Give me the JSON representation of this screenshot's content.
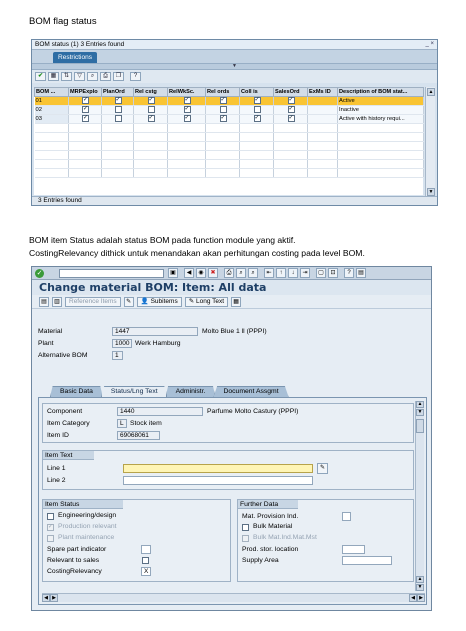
{
  "doc": {
    "heading": "BOM flag status",
    "paragraph_line1": "BOM item Status adalah status BOM pada function module yang aktif.",
    "paragraph_line2": "CostingRelevancy dithick untuk menandakan akan perhitungan costing pada level BOM."
  },
  "popup": {
    "title": "BOM status (1)   3 Entries found",
    "title_buttons": "_ ×",
    "tab_label": "Restrictions",
    "toolbar_icons": [
      "check-icon",
      "table-icon",
      "sort-icon",
      "filter-icon",
      "find-icon",
      "print-icon",
      "copy-icon",
      "help-icon"
    ],
    "columns": [
      "BOM ...",
      "MRPExplo",
      "PlanOrd",
      "Rel cstg",
      "RelWkSc.",
      "Rel ords",
      "Coll is",
      "SalesOrd",
      "ExMs ID",
      "Description of BOM stat..."
    ],
    "rows": [
      {
        "key": "01",
        "flags": [
          true,
          true,
          true,
          true,
          true,
          true,
          true
        ],
        "ext": "",
        "desc": "Active",
        "selected": true
      },
      {
        "key": "02",
        "flags": [
          true,
          false,
          false,
          true,
          false,
          false,
          true
        ],
        "ext": "",
        "desc": "Inactive",
        "selected": false
      },
      {
        "key": "03",
        "flags": [
          true,
          false,
          true,
          true,
          true,
          true,
          true
        ],
        "ext": "",
        "desc": "Active with history requi...",
        "selected": false
      }
    ],
    "status": "3 Entries found"
  },
  "sap": {
    "title": "Change material BOM: Item: All data",
    "toolbar": {
      "reference_items": "Reference Items",
      "subitems": "Subitems",
      "long_text": "Long Text"
    },
    "header": {
      "material_label": "Material",
      "material_value": "1447",
      "material_desc": "Molto Blue 1 ll (PPPI)",
      "plant_label": "Plant",
      "plant_value": "1000",
      "plant_desc": "Werk Hamburg",
      "altbom_label": "Alternative BOM",
      "altbom_value": "1"
    },
    "tabs": [
      "Basic Data",
      "Status/Lng Text",
      "Administr.",
      "Document Assgmt"
    ],
    "active_tab": "Status/Lng Text",
    "item": {
      "component_label": "Component",
      "component_value": "1440",
      "component_desc": "Parfume Molto Castury (PPPI)",
      "category_label": "Item Category",
      "category_value": "L",
      "category_desc": "Stock item",
      "itemid_label": "Item ID",
      "itemid_value": "69068061"
    },
    "item_text": {
      "title": "Item Text",
      "line1_label": "Line 1",
      "line1_value": "",
      "line2_label": "Line 2",
      "line2_value": ""
    },
    "item_status": {
      "title": "Item Status",
      "engineering": {
        "label": "Engineering/design",
        "checked": false
      },
      "production": {
        "label": "Production relevant",
        "checked": true
      },
      "plant_maint": {
        "label": "Plant maintenance",
        "checked": false
      },
      "spare_part_label": "Spare part indicator",
      "spare_part_value": "",
      "relevant_sales_label": "Relevant to sales",
      "costing_label": "CostingRelevancy",
      "costing_value": "X"
    },
    "further_data": {
      "title": "Further Data",
      "mat_provision_label": "Mat. Provision Ind.",
      "bulk_material_label": "Bulk Material",
      "bulk_matl_label": "Bulk Mat.Ind.Mat.Mst",
      "prod_stor_label": "Prod. stor. location",
      "supply_area_label": "Supply Area"
    }
  }
}
